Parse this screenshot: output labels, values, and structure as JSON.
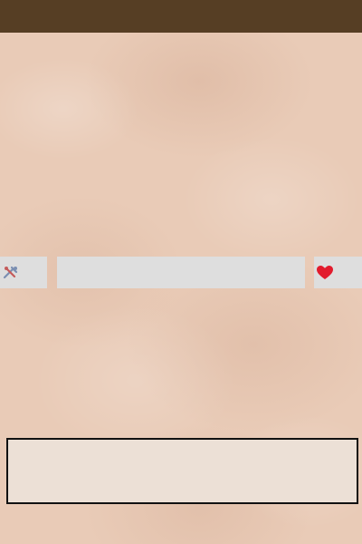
{
  "colors": {
    "top_bar": "#563e24",
    "toolbar_cell": "#dedede",
    "panel_bg": "#ece0d6",
    "panel_border": "#111111",
    "background": "#e9cbb7",
    "heart": "#e21b2d",
    "tools_icon": "#7b8fb2"
  },
  "toolbar": {
    "left_icon": "tools-icon",
    "right_icon": "heart-icon"
  },
  "bottom_panel": {
    "text": ""
  }
}
